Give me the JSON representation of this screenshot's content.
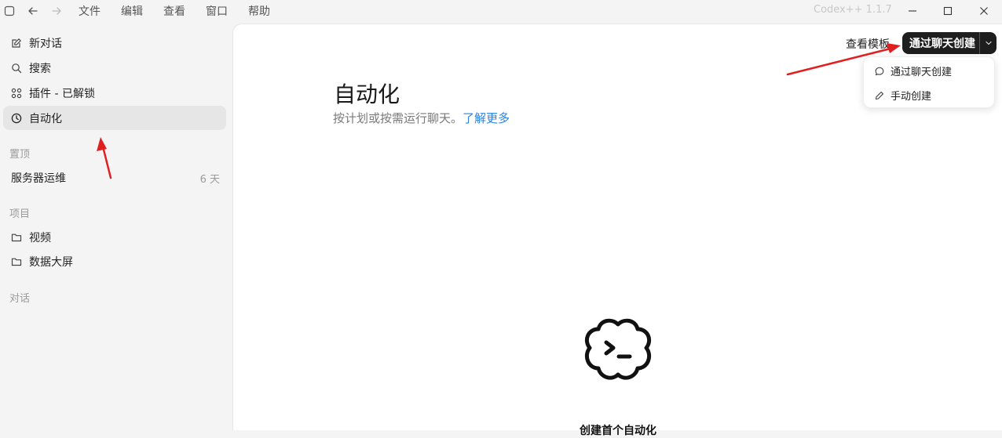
{
  "titlebar": {
    "menu": [
      "文件",
      "编辑",
      "查看",
      "窗口",
      "帮助"
    ],
    "app_name": "Codex++ 1.1.7"
  },
  "sidebar": {
    "nav": [
      {
        "label": "新对话",
        "icon": "edit-icon"
      },
      {
        "label": "搜索",
        "icon": "search-icon"
      },
      {
        "label": "插件 - 已解锁",
        "icon": "plugins-grid-icon"
      },
      {
        "label": "自动化",
        "icon": "clock-icon",
        "active": true
      }
    ],
    "pinned_label": "置顶",
    "pinned": [
      {
        "title": "服务器运维",
        "age": "6 天"
      }
    ],
    "projects_label": "项目",
    "projects": [
      {
        "label": "视频",
        "icon": "folder-icon"
      },
      {
        "label": "数据大屏",
        "icon": "folder-icon"
      }
    ],
    "chats_label": "对话"
  },
  "main": {
    "title": "自动化",
    "subtitle": "按计划或按需运行聊天。",
    "learn_more": "了解更多",
    "view_templates": "查看模板",
    "create_button": "通过聊天创建",
    "dropdown": [
      {
        "label": "通过聊天创建",
        "icon": "chat-bubble-icon"
      },
      {
        "label": "手动创建",
        "icon": "pencil-icon"
      }
    ],
    "empty_title": "创建首个自动化"
  },
  "colors": {
    "accent_link": "#2a82e4",
    "primary_button": "#1e1e1e",
    "annotation": "#e02020"
  }
}
